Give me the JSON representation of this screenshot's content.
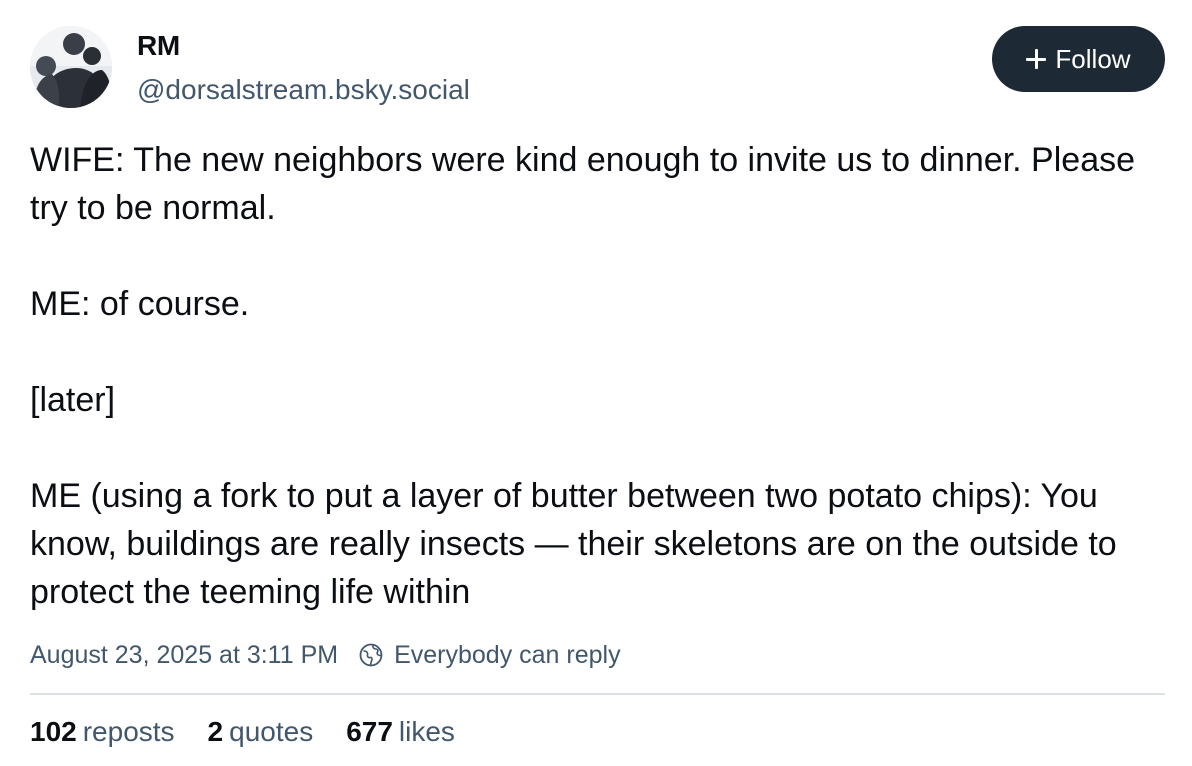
{
  "author": {
    "display_name": "RM",
    "handle": "@dorsalstream.bsky.social",
    "avatar_icon": "profile-photo"
  },
  "follow_button": {
    "label": "Follow",
    "icon": "plus-icon",
    "background": "#1e2936"
  },
  "post": {
    "paragraphs": [
      "WIFE: The new neighbors were kind enough to invite us to dinner. Please try to be normal.",
      "ME: of course.",
      "[later]",
      "ME (using a fork to put a layer of butter between two potato chips): You know, buildings are really insects — their skeletons are on the outside to protect the teeming life within"
    ]
  },
  "meta": {
    "timestamp": "August 23, 2025 at 3:11 PM",
    "reply_setting": "Everybody can reply",
    "reply_icon": "globe-icon"
  },
  "stats": {
    "reposts_count": "102",
    "reposts_label": "reposts",
    "quotes_count": "2",
    "quotes_label": "quotes",
    "likes_count": "677",
    "likes_label": "likes"
  },
  "colors": {
    "text_primary": "#0b0f14",
    "text_secondary": "#42576c",
    "divider": "#dbe1e7"
  }
}
